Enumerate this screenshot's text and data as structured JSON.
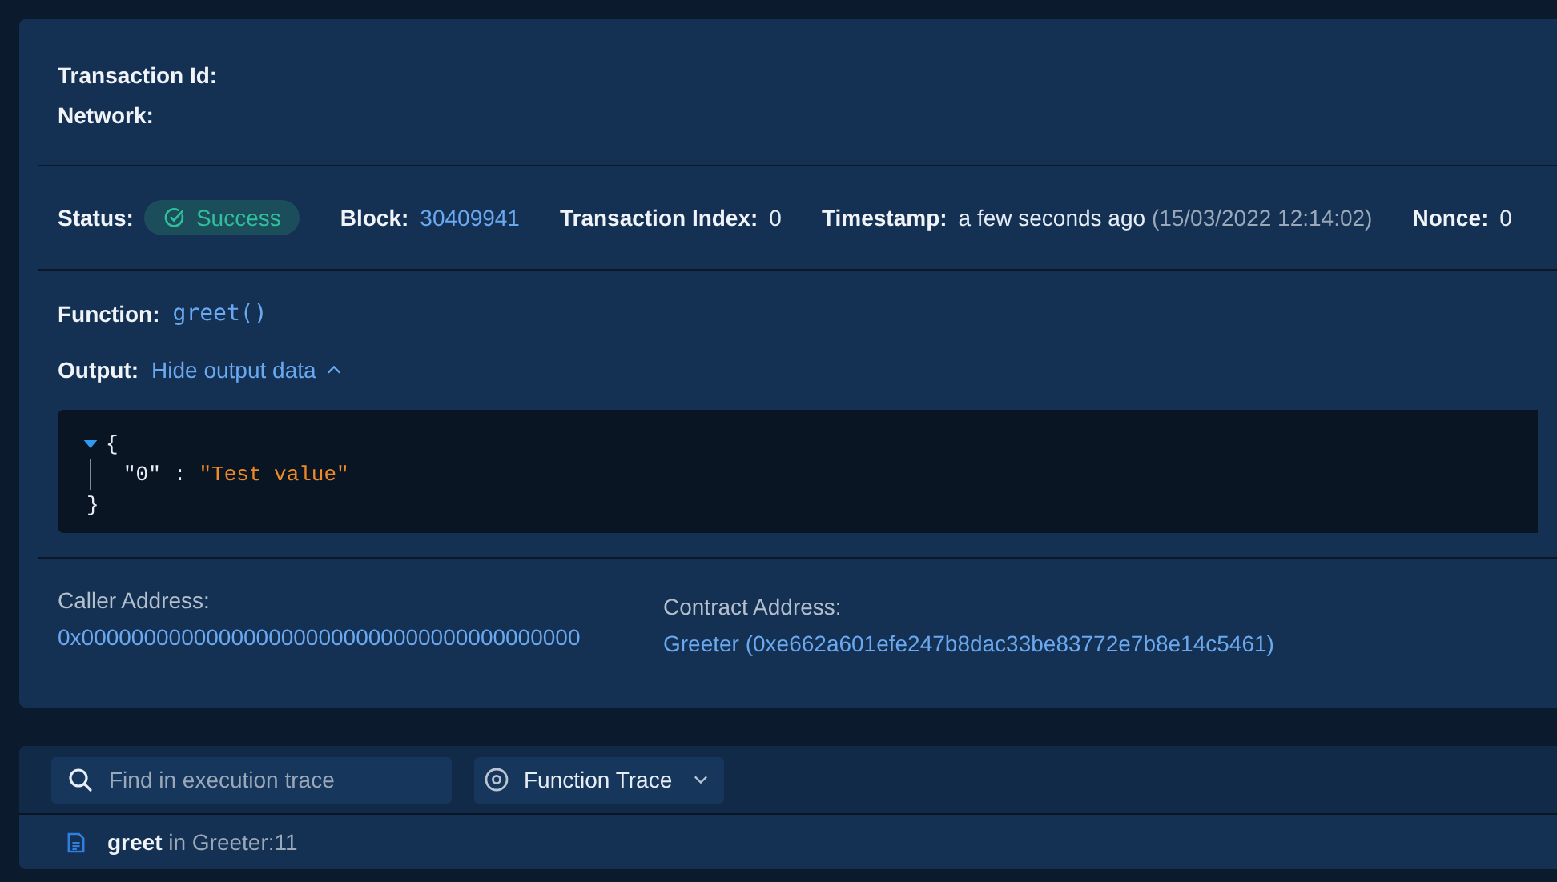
{
  "header": {
    "fields": [
      {
        "label": "Transaction Id:"
      },
      {
        "label": "Network:"
      }
    ]
  },
  "summary": [
    {
      "kind": "badge",
      "label": "Status:",
      "value": "Success"
    },
    {
      "kind": "link",
      "label": "Block:",
      "value": "30409941"
    },
    {
      "kind": "text",
      "label": "Transaction Index:",
      "value": "0"
    },
    {
      "kind": "timestamp",
      "label": "Timestamp:",
      "value": "a few seconds ago",
      "detail": "(15/03/2022 12:14:02)"
    },
    {
      "kind": "text",
      "label": "Nonce:",
      "value": "0"
    }
  ],
  "function": {
    "label": "Function:",
    "value": "greet()"
  },
  "output": {
    "label": "Output:",
    "toggle": "Hide output data",
    "expanded": true,
    "open_brace": "{",
    "close_brace": "}",
    "entries": [
      {
        "key": "\"0\"",
        "separator": ":",
        "value": "\"Test value\""
      }
    ]
  },
  "addresses": [
    {
      "label": "Caller Address:",
      "value": "0x0000000000000000000000000000000000000000"
    },
    {
      "label": "Contract Address:",
      "value": "Greeter (0xe662a601efe247b8dac33be83772e7b8e14c5461)"
    }
  ],
  "trace": {
    "search": {
      "placeholder": "Find in execution trace"
    },
    "view": "Function Trace",
    "rows": [
      {
        "function": "greet",
        "connector": "in",
        "location": "Greeter:11"
      }
    ]
  }
}
